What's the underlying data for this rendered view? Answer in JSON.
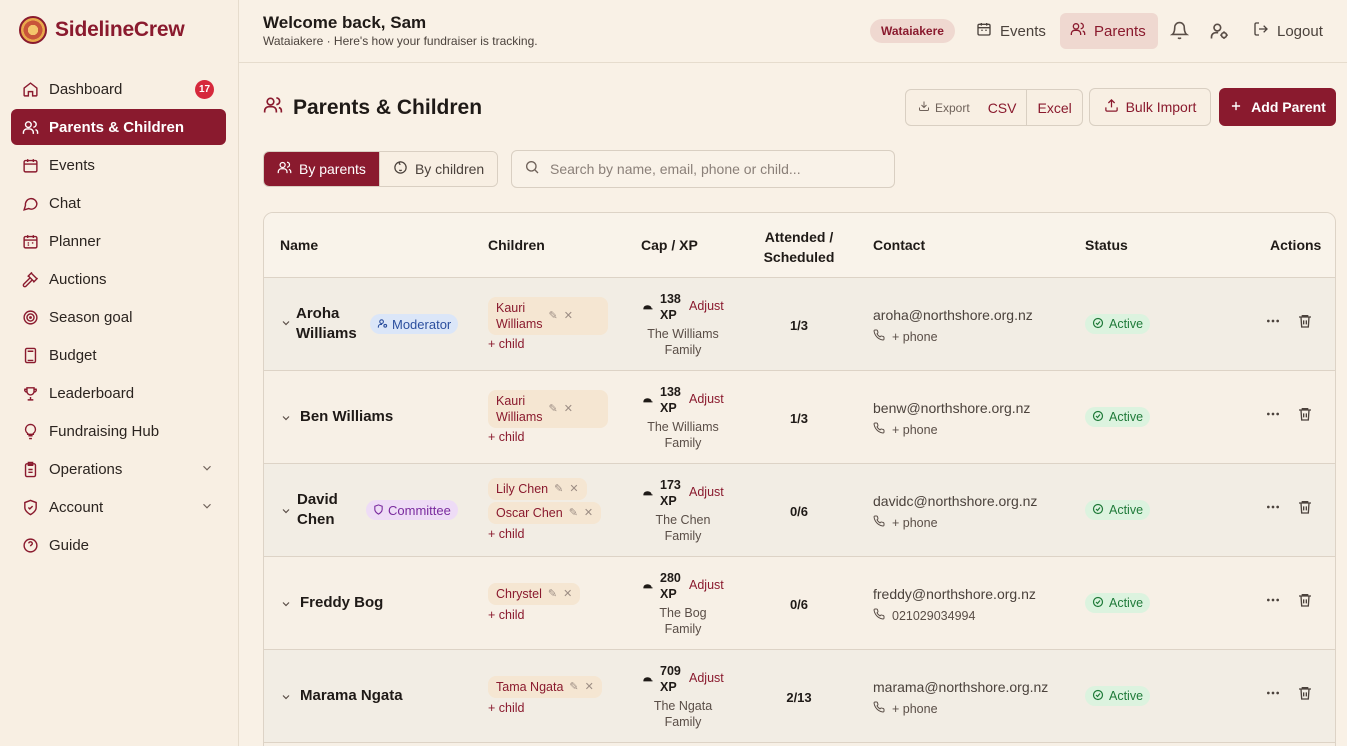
{
  "brand": {
    "name": "SidelineCrew"
  },
  "sidebar": {
    "items": [
      {
        "label": "Dashboard",
        "icon": "home-icon",
        "badge": "17"
      },
      {
        "label": "Parents & Children",
        "icon": "users-icon",
        "active": true
      },
      {
        "label": "Events",
        "icon": "calendar-icon"
      },
      {
        "label": "Chat",
        "icon": "chat-icon"
      },
      {
        "label": "Planner",
        "icon": "planner-icon"
      },
      {
        "label": "Auctions",
        "icon": "gavel-icon"
      },
      {
        "label": "Season goal",
        "icon": "target-icon"
      },
      {
        "label": "Budget",
        "icon": "calculator-icon"
      },
      {
        "label": "Leaderboard",
        "icon": "trophy-icon"
      },
      {
        "label": "Fundraising Hub",
        "icon": "lightbulb-icon"
      },
      {
        "label": "Operations",
        "icon": "clipboard-icon",
        "expandable": true
      },
      {
        "label": "Account",
        "icon": "shield-icon",
        "expandable": true
      },
      {
        "label": "Guide",
        "icon": "help-icon"
      }
    ]
  },
  "header": {
    "welcome": "Welcome back, Sam",
    "subtitle": "Wataiakere · Here's how your fundraiser is tracking.",
    "club": "Wataiakere",
    "events_label": "Events",
    "parents_label": "Parents",
    "logout_label": "Logout"
  },
  "page": {
    "title": "Parents & Children",
    "export_label": "Export",
    "csv_label": "CSV",
    "excel_label": "Excel",
    "bulk_import_label": "Bulk Import",
    "add_parent_label": "Add Parent",
    "view_by_parents": "By parents",
    "view_by_children": "By children",
    "search_placeholder": "Search by name, email, phone or child..."
  },
  "table": {
    "headers": {
      "name": "Name",
      "children": "Children",
      "cap_xp": "Cap / XP",
      "attended_1": "Attended /",
      "attended_2": "Scheduled",
      "contact": "Contact",
      "status": "Status",
      "actions": "Actions"
    },
    "add_child_label": "+ child",
    "adjust_label": "Adjust",
    "rows": [
      {
        "name_1": "Aroha",
        "name_2": "Williams",
        "role": "Moderator",
        "children": [
          {
            "l1": "Kauri",
            "l2": "Williams"
          }
        ],
        "xp_1": "138",
        "xp_2": "XP",
        "family_1": "The Williams",
        "family_2": "Family",
        "attended": "1/3",
        "email": "aroha@northshore.org.nz",
        "phone": "+ phone",
        "status": "Active"
      },
      {
        "name_1": "Ben Williams",
        "children": [
          {
            "l1": "Kauri",
            "l2": "Williams"
          }
        ],
        "xp_1": "138",
        "xp_2": "XP",
        "family_1": "The Williams",
        "family_2": "Family",
        "attended": "1/3",
        "email": "benw@northshore.org.nz",
        "phone": "+ phone",
        "status": "Active"
      },
      {
        "name_1": "David",
        "name_2": "Chen",
        "role": "Committee",
        "children": [
          {
            "l1": "Lily Chen"
          },
          {
            "l1": "Oscar Chen"
          }
        ],
        "xp_1": "173",
        "xp_2": "XP",
        "family_1": "The Chen",
        "family_2": "Family",
        "attended": "0/6",
        "email": "davidc@northshore.org.nz",
        "phone": "+ phone",
        "status": "Active"
      },
      {
        "name_1": "Freddy Bog",
        "children": [
          {
            "l1": "Chrystel"
          }
        ],
        "xp_1": "280",
        "xp_2": "XP",
        "family_1": "The Bog",
        "family_2": "Family",
        "attended": "0/6",
        "email": "freddy@northshore.org.nz",
        "phone": "021029034994",
        "status": "Active"
      },
      {
        "name_1": "Marama Ngata",
        "children": [
          {
            "l1": "Tama Ngata"
          }
        ],
        "xp_1": "709",
        "xp_2": "XP",
        "family_1": "The Ngata",
        "family_2": "Family",
        "attended": "2/13",
        "email": "marama@northshore.org.nz",
        "phone": "+ phone",
        "status": "Active"
      }
    ]
  },
  "colors": {
    "brand": "#8a1a2e",
    "background": "#f9f1e6",
    "active_status": "#1f7a39",
    "badge": "#d6283c"
  }
}
